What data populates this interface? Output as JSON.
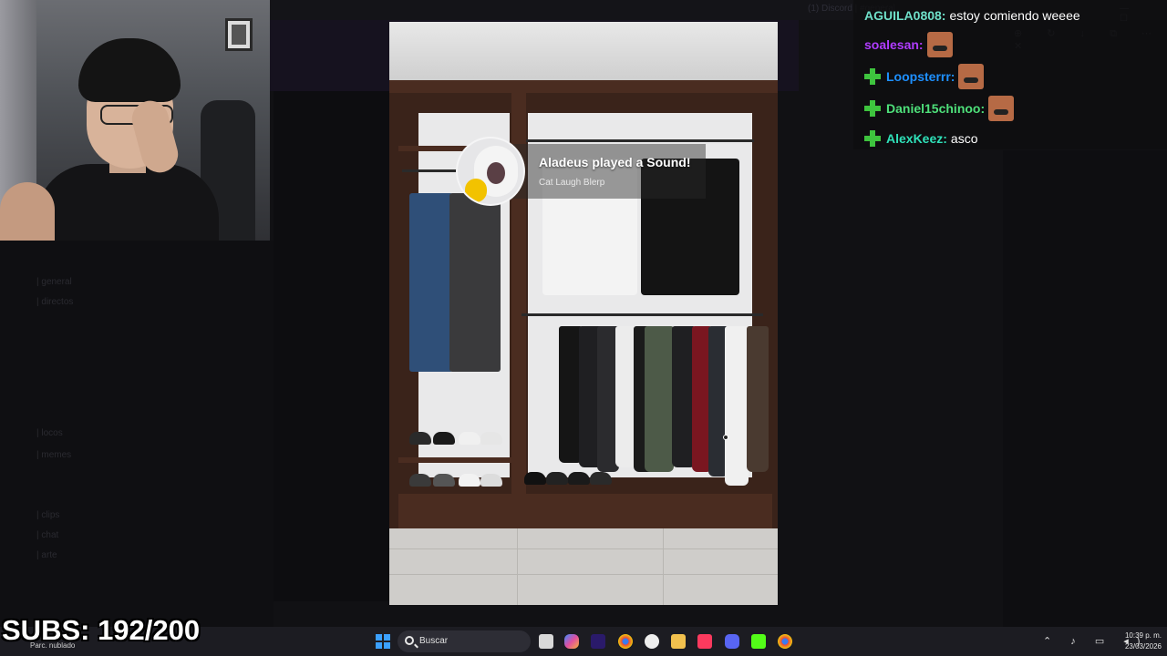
{
  "background_app": {
    "window_title": "(1) Discord | #general",
    "channels": [
      "| general",
      "| directos",
      "| locos",
      "| memes",
      "| clips",
      "| chat",
      "| arte"
    ]
  },
  "notification": {
    "title": "Aladeus played a Sound!",
    "subtitle": "Cat Laugh Blerp"
  },
  "chat": {
    "messages": [
      {
        "user": "AGUILA0808:",
        "text": "estoy comiendo weeee",
        "color": "#6fe0c9",
        "badge": false,
        "emote": false
      },
      {
        "user": "soalesan:",
        "text": "",
        "color": "#b03cff",
        "badge": false,
        "emote": true
      },
      {
        "user": "Loopsterrr:",
        "text": "",
        "color": "#1e90ff",
        "badge": true,
        "emote": true
      },
      {
        "user": "Daniel15chinoo:",
        "text": "",
        "color": "#4ee07a",
        "badge": true,
        "emote": true
      },
      {
        "user": "AlexKeez:",
        "text": "asco",
        "color": "#2fe0b8",
        "badge": true,
        "emote": false
      }
    ]
  },
  "overlay": {
    "subs": "SUBS: 192/200"
  },
  "taskbar": {
    "weather": "Parc. nublado",
    "search_placeholder": "Buscar",
    "time": "10:39 p. m.",
    "date": "23/03/2026",
    "icons": [
      "start-icon",
      "search-icon",
      "task-view-icon",
      "copilot-icon",
      "premiere-icon",
      "chrome-icon",
      "obs-icon",
      "file-explorer-icon",
      "itunes-icon",
      "discord-icon",
      "kick-icon",
      "chrome-profile-icon"
    ]
  }
}
